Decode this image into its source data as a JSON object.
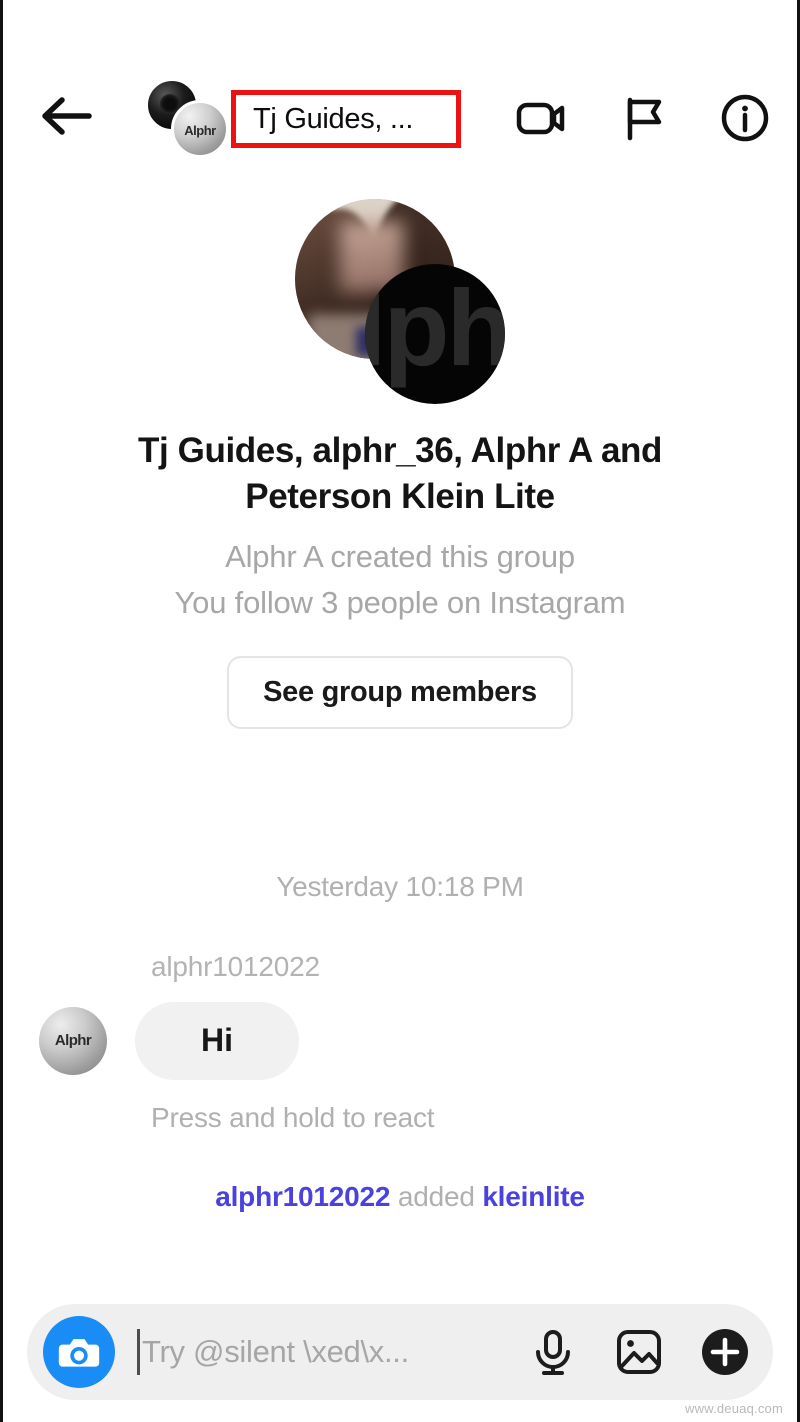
{
  "header": {
    "back_label": "Back",
    "title_truncated": "Tj Guides, ...",
    "avatar_front_mark": "Alphr",
    "icons": {
      "video_call": "video-call-icon",
      "flag": "flag-icon",
      "info": "info-icon"
    },
    "highlight_color": "#ee1111"
  },
  "profile": {
    "logo_glyph": "lph",
    "title": "Tj Guides, alphr_36, Alphr A and Peterson Klein Lite",
    "subtitle_1": "Alphr A created this group",
    "subtitle_2": "You follow 3 people on Instagram",
    "members_button": "See group members"
  },
  "thread": {
    "day_separator": "Yesterday 10:18 PM",
    "message": {
      "sender": "alphr1012022",
      "avatar_mark": "Alphr",
      "text": "Hi",
      "react_hint": "Press and hold to react"
    },
    "system_message": {
      "actor": "alphr1012022",
      "action": " added ",
      "target": "kleinlite",
      "link_color": "#4a41e0"
    }
  },
  "composer": {
    "camera_label": "camera-button",
    "placeholder": "Try @silent \\xed\\x...",
    "input_value": "",
    "accent_color": "#1a8cf5",
    "actions": {
      "mic": "microphone-icon",
      "gallery": "gallery-icon",
      "add": "add-icon"
    }
  },
  "watermark": "www.deuaq.com"
}
